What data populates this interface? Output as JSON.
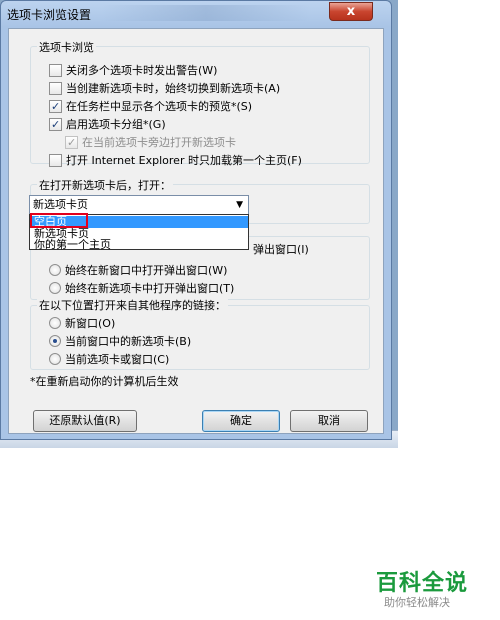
{
  "window": {
    "title": "选项卡浏览设置",
    "close_label": "x"
  },
  "tab_browsing": {
    "group_title": "选项卡浏览",
    "options": [
      {
        "label": "关闭多个选项卡时发出警告(W)",
        "checked": false,
        "disabled": false
      },
      {
        "label": "当创建新选项卡时，始终切换到新选项卡(A)",
        "checked": false,
        "disabled": false
      },
      {
        "label": "在任务栏中显示各个选项卡的预览*(S)",
        "checked": true,
        "disabled": false
      },
      {
        "label": "启用选项卡分组*(G)",
        "checked": true,
        "disabled": false
      },
      {
        "label": "在当前选项卡旁边打开新选项卡",
        "checked": true,
        "disabled": true
      },
      {
        "label": "打开 Internet Explorer 时只加载第一个主页(F)",
        "checked": false,
        "disabled": false
      }
    ]
  },
  "new_tab": {
    "group_title": "在打开新选项卡后，打开：",
    "selected": "新选项卡页",
    "dropdown_options": [
      "空白页",
      "新选项卡页",
      "你的第一个主页"
    ]
  },
  "popups": {
    "title_partial": "遇",
    "first_option_partial": "弹出窗口(I)",
    "options": [
      {
        "label": "始终在新窗口中打开弹出窗口(W)",
        "checked": false
      },
      {
        "label": "始终在新选项卡中打开弹出窗口(T)",
        "checked": false
      }
    ]
  },
  "links": {
    "group_title": "在以下位置打开来自其他程序的链接：",
    "options": [
      {
        "label": "新窗口(O)",
        "checked": false
      },
      {
        "label": "当前窗口中的新选项卡(B)",
        "checked": true
      },
      {
        "label": "当前选项卡或窗口(C)",
        "checked": false
      }
    ]
  },
  "footnote": "*在重新启动你的计算机后生效",
  "buttons": {
    "restore": "还原默认值(R)",
    "ok": "确定",
    "cancel": "取消"
  },
  "watermark": {
    "main": "百科全说",
    "sub": "助你轻松解决"
  },
  "colors": {
    "selection": "#3399ff",
    "highlight_box": "#e1001e",
    "brand": "#1b9a3d"
  }
}
